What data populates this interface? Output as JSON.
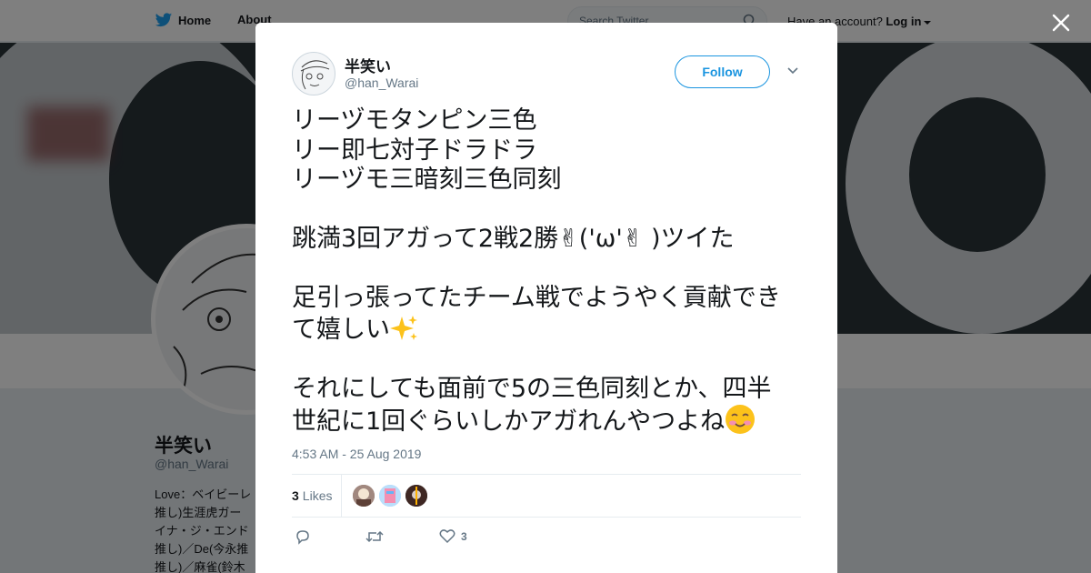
{
  "topbar": {
    "home_label": "Home",
    "about_label": "About",
    "search_placeholder": "Search Twitter",
    "account_prompt": "Have an account?",
    "login_label": "Log in"
  },
  "profile": {
    "name": "半笑い",
    "handle": "@han_Warai",
    "bio_lines": [
      "Love：ベイビーレ",
      "推し)生涯虎ガー",
      "イナ・ジ・エンド",
      "推し)／De(今永推",
      "推し)／麻雀(鈴木"
    ]
  },
  "tweet": {
    "author_name": "半笑い",
    "author_handle": "@han_Warai",
    "follow_label": "Follow",
    "lines": [
      "リーヅモタンピン三色",
      "リー即七対子ドラドラ",
      "リーヅモ三暗刻三色同刻",
      "",
      "跳満3回アガって2戦2勝✌('ω'✌ )ツイた",
      "",
      "足引っ張ってたチーム戦でようやく貢献でき",
      "て嬉しい",
      "",
      "それにしても面前で5の三色同刻とか、四半",
      "世紀に1回ぐらいしかアガれんやつよね"
    ],
    "timestamp": "4:53 AM - 25 Aug 2019",
    "likes_count": "3",
    "likes_label": "Likes",
    "like_action_count": "3"
  },
  "icons": {
    "home": "twitter-bird-icon",
    "search": "search-icon",
    "close": "close-icon",
    "caret": "chevron-down-icon",
    "reply": "reply-icon",
    "retweet": "retweet-icon",
    "like": "heart-icon",
    "sparkles": "sparkles-emoji",
    "blush": "smiling-face-emoji"
  },
  "colors": {
    "accent": "#1b95e0",
    "text": "#14171a",
    "muted": "#657786"
  }
}
